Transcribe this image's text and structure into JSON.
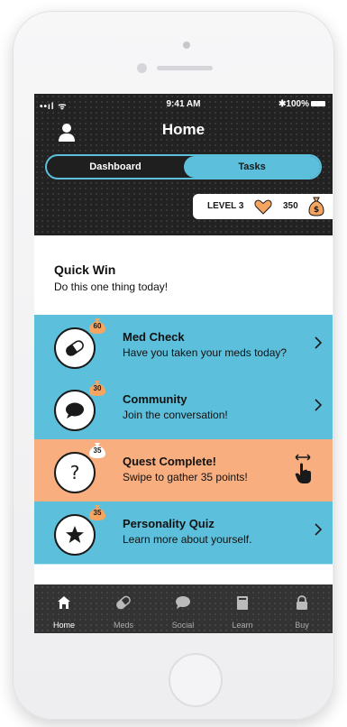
{
  "status_bar": {
    "signal": "••ıl ᯤ",
    "time": "9:41 AM",
    "battery": "✱100%"
  },
  "header": {
    "title": "Home",
    "tabs": [
      {
        "label": "Dashboard",
        "active": false
      },
      {
        "label": "Tasks",
        "active": true
      }
    ],
    "level": "LEVEL 3",
    "points": "350"
  },
  "quick_win": {
    "title": "Quick Win",
    "subtitle": "Do this one thing today!"
  },
  "tasks": [
    {
      "title": "Med Check",
      "subtitle": "Have you taken your meds today?",
      "points": "60",
      "icon": "pill-icon",
      "color": "#5cbfdb",
      "action": "chevron"
    },
    {
      "title": "Community",
      "subtitle": "Join the conversation!",
      "points": "30",
      "icon": "chat-bubble-icon",
      "color": "#5cbfdb",
      "action": "chevron"
    },
    {
      "title": "Quest Complete!",
      "subtitle": "Swipe to gather 35 points!",
      "points": "35",
      "icon": "question-mark-icon",
      "color": "#f8ae7f",
      "action": "swipe"
    },
    {
      "title": "Personality Quiz",
      "subtitle": "Learn more about yourself.",
      "points": "35",
      "icon": "star-icon",
      "color": "#5cbfdb",
      "action": "chevron"
    }
  ],
  "tab_bar": [
    {
      "label": "Home",
      "icon": "home-icon",
      "active": true
    },
    {
      "label": "Meds",
      "icon": "pill-icon",
      "active": false
    },
    {
      "label": "Social",
      "icon": "chat-bubble-icon",
      "active": false
    },
    {
      "label": "Learn",
      "icon": "book-icon",
      "active": false
    },
    {
      "label": "Buy",
      "icon": "lock-icon",
      "active": false
    }
  ],
  "colors": {
    "accent_blue": "#5cbfdb",
    "accent_orange": "#f8ae7f",
    "header_dark": "#222222",
    "badge_orange": "#f6a561"
  }
}
